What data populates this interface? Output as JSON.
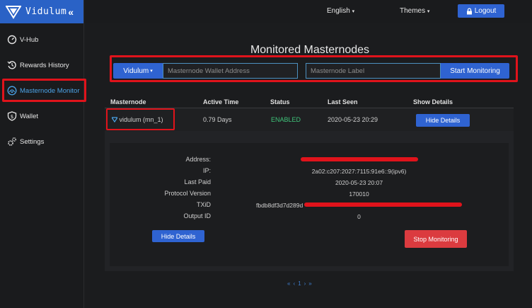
{
  "brand": {
    "name": "Vidulum",
    "collapse_glyph": "«"
  },
  "sidebar": {
    "items": [
      {
        "label": "V-Hub",
        "icon": "gauge-icon"
      },
      {
        "label": "Rewards History",
        "icon": "history-icon"
      },
      {
        "label": "Masternode Monitor",
        "icon": "masternode-icon",
        "active": true
      },
      {
        "label": "Wallet",
        "icon": "wallet-icon"
      },
      {
        "label": "Settings",
        "icon": "gears-icon"
      }
    ]
  },
  "topbar": {
    "language": "English",
    "themes": "Themes",
    "logout": "Logout"
  },
  "page": {
    "title": "Monitored Masternodes"
  },
  "search": {
    "coin": "Vidulum",
    "address_placeholder": "Masternode Wallet Address",
    "label_placeholder": "Masternode Label",
    "start_button": "Start Monitoring"
  },
  "table": {
    "headers": [
      "Masternode",
      "Active Time",
      "Status",
      "Last Seen",
      "Show Details"
    ],
    "row": {
      "masternode": "vidulum (mn_1)",
      "active_time": "0.79 Days",
      "status": "ENABLED",
      "last_seen": "2020-05-23 20:29",
      "toggle": "Hide Details"
    }
  },
  "details": {
    "labels": [
      "Address:",
      "IP:",
      "Last Paid",
      "Protocol Version",
      "TXiD",
      "Output ID"
    ],
    "ip": "2a02:c207:2027:7115:91e6::9(ipv6)",
    "last_paid": "2020-05-23 20:07",
    "protocol_version": "170010",
    "txid_prefix": "fbdb8df3d7d289d",
    "output_id": "0",
    "hide_button": "Hide Details",
    "stop_button": "Stop Monitoring"
  },
  "pager": {
    "first": "«",
    "prev": "‹",
    "current": "1",
    "next": "›",
    "last": "»"
  },
  "colors": {
    "accent": "#2f63d1",
    "danger": "#db3b3f",
    "enabled": "#3fc47a",
    "highlight": "#e0131b"
  }
}
